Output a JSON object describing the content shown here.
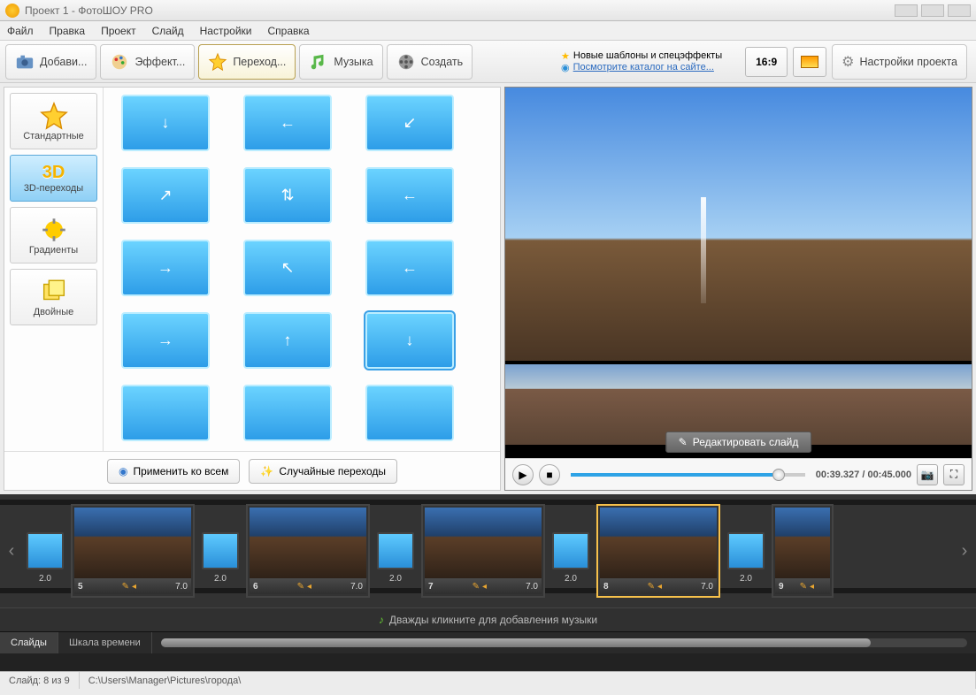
{
  "window": {
    "title": "Проект 1 - ФотоШОУ PRO"
  },
  "menu": {
    "items": [
      "Файл",
      "Правка",
      "Проект",
      "Слайд",
      "Настройки",
      "Справка"
    ]
  },
  "toolbar": {
    "tabs": [
      {
        "label": "Добави..."
      },
      {
        "label": "Эффект..."
      },
      {
        "label": "Переход..."
      },
      {
        "label": "Музыка"
      },
      {
        "label": "Создать"
      }
    ],
    "promo_line1": "Новые шаблоны и спецэффекты",
    "promo_line2": "Посмотрите каталог на сайте...",
    "aspect": "16:9",
    "settings": "Настройки проекта"
  },
  "categories": [
    {
      "label": "Стандартные"
    },
    {
      "label": "3D-переходы"
    },
    {
      "label": "Градиенты"
    },
    {
      "label": "Двойные"
    }
  ],
  "left_buttons": {
    "apply_all": "Применить ко всем",
    "random": "Случайные переходы"
  },
  "preview": {
    "edit": "Редактировать слайд",
    "time": "00:39.327 / 00:45.000"
  },
  "timeline": {
    "transitions_dur": "2.0",
    "slides": [
      {
        "n": "5",
        "dur": "7.0"
      },
      {
        "n": "6",
        "dur": "7.0"
      },
      {
        "n": "7",
        "dur": "7.0"
      },
      {
        "n": "8",
        "dur": "7.0"
      },
      {
        "n": "9",
        "dur": ""
      }
    ],
    "music_hint": "Дважды кликните для добавления музыки",
    "tabs": {
      "slides": "Слайды",
      "time": "Шкала времени"
    }
  },
  "status": {
    "slide": "Слайд: 8 из 9",
    "path": "C:\\Users\\Manager\\Pictures\\города\\"
  }
}
